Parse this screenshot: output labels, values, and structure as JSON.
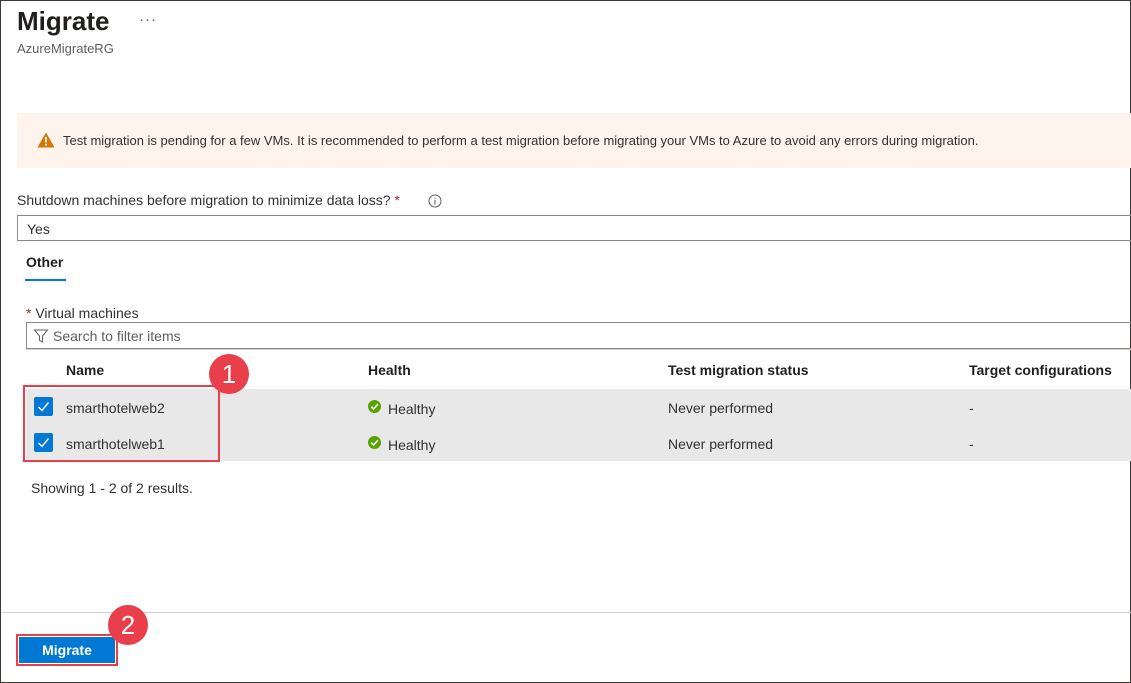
{
  "header": {
    "title": "Migrate",
    "more_label": "···",
    "subtitle": "AzureMigrateRG"
  },
  "banner": {
    "icon": "warning-icon",
    "text": "Test migration is pending for a few VMs. It is recommended to perform a test migration before migrating your VMs to Azure to avoid any errors during migration.",
    "color": "#fff4ec",
    "icon_color": "#d47500"
  },
  "shutdown_field": {
    "label": "Shutdown machines before migration to minimize data loss?",
    "required_mark": "*",
    "info_icon": "info-icon",
    "value": "Yes"
  },
  "tabs": [
    {
      "label": "Other",
      "selected": true
    }
  ],
  "vm_section": {
    "required_mark": "*",
    "label": "Virtual machines",
    "filter_placeholder": "Search to filter items",
    "columns": [
      "Name",
      "Health",
      "Test migration status",
      "Target configurations"
    ],
    "rows": [
      {
        "checked": true,
        "name": "smarthotelweb2",
        "health": "Healthy",
        "status": "Never performed",
        "target": "-"
      },
      {
        "checked": true,
        "name": "smarthotelweb1",
        "health": "Healthy",
        "status": "Never performed",
        "target": "-"
      }
    ],
    "results_text": "Showing 1 - 2 of 2 results."
  },
  "footer": {
    "migrate_label": "Migrate"
  },
  "annotations": {
    "badge1": "1",
    "badge2": "2",
    "color": "#e83f4a"
  },
  "colors": {
    "accent": "#0078d4",
    "healthy": "#57a300",
    "required": "#a4262c"
  }
}
